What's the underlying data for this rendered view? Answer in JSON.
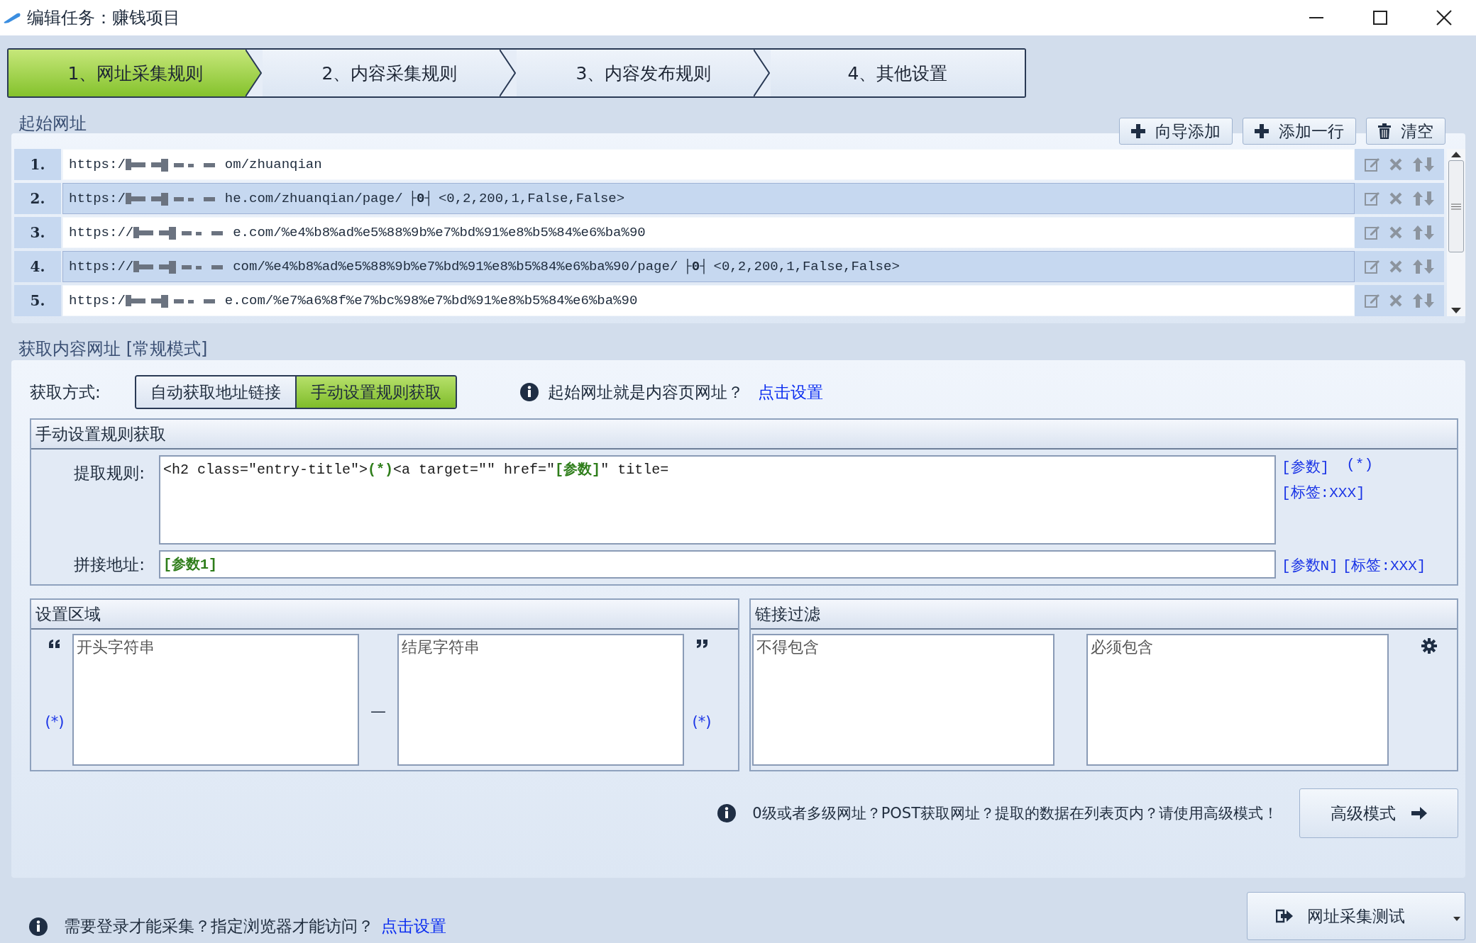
{
  "window": {
    "title": "编辑任务：赚钱项目"
  },
  "steps": [
    {
      "label": "1、网址采集规则",
      "selected": true
    },
    {
      "label": "2、内容采集规则",
      "selected": false
    },
    {
      "label": "3、内容发布规则",
      "selected": false
    },
    {
      "label": "4、其他设置",
      "selected": false
    }
  ],
  "start_urls": {
    "title": "起始网址",
    "buttons": [
      {
        "label": "向导添加",
        "kind": "plus"
      },
      {
        "label": "添加一行",
        "kind": "plus"
      },
      {
        "label": "清空",
        "kind": "trash"
      }
    ],
    "rows": [
      {
        "number": "1.",
        "prefix": "https:/",
        "suffix": "om/zhuanqian",
        "selected": false
      },
      {
        "number": "2.",
        "prefix": "https:/",
        "suffix": "he.com/zhuanqian/page/",
        "range": "├0┤",
        "params": "<0,2,200,1,False,False>",
        "selected": true
      },
      {
        "number": "3.",
        "prefix": "https://",
        "suffix": "e.com/%e4%b8%ad%e5%88%9b%e7%bd%91%e8%b5%84%e6%ba%90",
        "selected": false
      },
      {
        "number": "4.",
        "prefix": "https://",
        "suffix": "com/%e4%b8%ad%e5%88%9b%e7%bd%91%e8%b5%84%e6%ba%90/page/",
        "range": "├0┤",
        "params": "<0,2,200,1,False,False>",
        "selected": true
      },
      {
        "number": "5.",
        "prefix": "https:/",
        "suffix": "e.com/%e7%a6%8f%e7%bc%98%e7%bd%91%e8%b5%84%e6%ba%90",
        "selected": false
      }
    ]
  },
  "content_urls": {
    "title": "获取内容网址 [常规模式]",
    "method_label": "获取方式:",
    "methods": [
      {
        "label": "自动获取地址链接",
        "selected": false
      },
      {
        "label": "手动设置规则获取",
        "selected": true
      }
    ],
    "hint": "起始网址就是内容页网址？",
    "hint_link": "点击设置",
    "manual": {
      "title": "手动设置规则获取",
      "rule_label": "提取规则:",
      "rule_parts": [
        {
          "text": "<h2 class=\"entry-title\">",
          "kind": "plain"
        },
        {
          "text": "(*)",
          "kind": "token"
        },
        {
          "text": "<a target=\"\" href=\"",
          "kind": "plain"
        },
        {
          "text": "[参数]",
          "kind": "token"
        },
        {
          "text": "\" title=",
          "kind": "plain"
        }
      ],
      "rule_links": [
        "[参数]",
        "(*)",
        "[标签:XXX]"
      ],
      "join_label": "拼接地址:",
      "join_value": "[参数1]",
      "join_links": [
        "[参数N]",
        "[标签:XXX]"
      ]
    },
    "region": {
      "title": "设置区域",
      "start_token": "(*)",
      "start_placeholder": "开头字符串",
      "separator": "—",
      "end_placeholder": "结尾字符串",
      "end_token": "(*)"
    },
    "filter": {
      "title": "链接过滤",
      "exclude_placeholder": "不得包含",
      "include_placeholder": "必须包含"
    },
    "advanced_hint": "0级或者多级网址？POST获取网址？提取的数据在列表页内？请使用高级模式！",
    "advanced_button": "高级模式"
  },
  "footer": {
    "hint": "需要登录才能采集？指定浏览器才能访问？",
    "link": "点击设置",
    "test_button": "网址采集测试"
  }
}
